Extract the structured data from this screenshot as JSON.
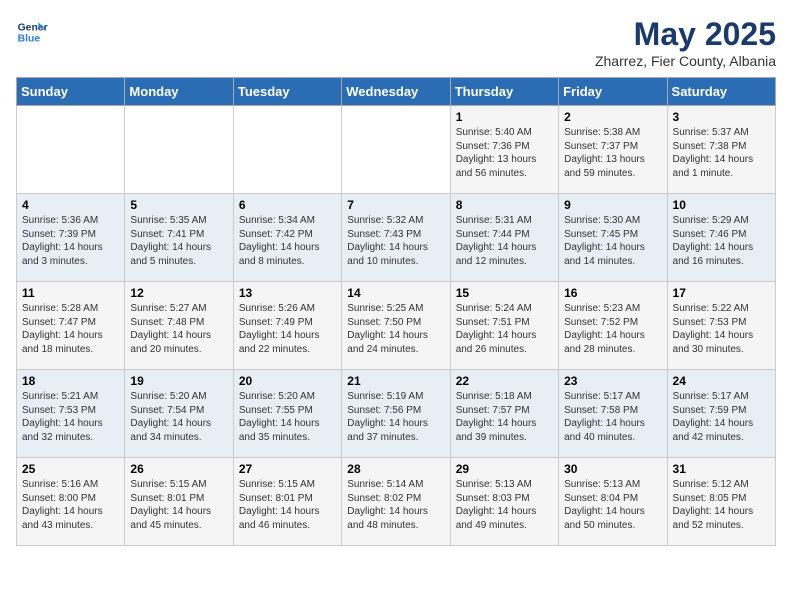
{
  "header": {
    "logo_line1": "General",
    "logo_line2": "Blue",
    "month_title": "May 2025",
    "subtitle": "Zharrez, Fier County, Albania"
  },
  "weekdays": [
    "Sunday",
    "Monday",
    "Tuesday",
    "Wednesday",
    "Thursday",
    "Friday",
    "Saturday"
  ],
  "weeks": [
    [
      {
        "day": "",
        "text": ""
      },
      {
        "day": "",
        "text": ""
      },
      {
        "day": "",
        "text": ""
      },
      {
        "day": "",
        "text": ""
      },
      {
        "day": "1",
        "text": "Sunrise: 5:40 AM\nSunset: 7:36 PM\nDaylight: 13 hours and 56 minutes."
      },
      {
        "day": "2",
        "text": "Sunrise: 5:38 AM\nSunset: 7:37 PM\nDaylight: 13 hours and 59 minutes."
      },
      {
        "day": "3",
        "text": "Sunrise: 5:37 AM\nSunset: 7:38 PM\nDaylight: 14 hours and 1 minute."
      }
    ],
    [
      {
        "day": "4",
        "text": "Sunrise: 5:36 AM\nSunset: 7:39 PM\nDaylight: 14 hours and 3 minutes."
      },
      {
        "day": "5",
        "text": "Sunrise: 5:35 AM\nSunset: 7:41 PM\nDaylight: 14 hours and 5 minutes."
      },
      {
        "day": "6",
        "text": "Sunrise: 5:34 AM\nSunset: 7:42 PM\nDaylight: 14 hours and 8 minutes."
      },
      {
        "day": "7",
        "text": "Sunrise: 5:32 AM\nSunset: 7:43 PM\nDaylight: 14 hours and 10 minutes."
      },
      {
        "day": "8",
        "text": "Sunrise: 5:31 AM\nSunset: 7:44 PM\nDaylight: 14 hours and 12 minutes."
      },
      {
        "day": "9",
        "text": "Sunrise: 5:30 AM\nSunset: 7:45 PM\nDaylight: 14 hours and 14 minutes."
      },
      {
        "day": "10",
        "text": "Sunrise: 5:29 AM\nSunset: 7:46 PM\nDaylight: 14 hours and 16 minutes."
      }
    ],
    [
      {
        "day": "11",
        "text": "Sunrise: 5:28 AM\nSunset: 7:47 PM\nDaylight: 14 hours and 18 minutes."
      },
      {
        "day": "12",
        "text": "Sunrise: 5:27 AM\nSunset: 7:48 PM\nDaylight: 14 hours and 20 minutes."
      },
      {
        "day": "13",
        "text": "Sunrise: 5:26 AM\nSunset: 7:49 PM\nDaylight: 14 hours and 22 minutes."
      },
      {
        "day": "14",
        "text": "Sunrise: 5:25 AM\nSunset: 7:50 PM\nDaylight: 14 hours and 24 minutes."
      },
      {
        "day": "15",
        "text": "Sunrise: 5:24 AM\nSunset: 7:51 PM\nDaylight: 14 hours and 26 minutes."
      },
      {
        "day": "16",
        "text": "Sunrise: 5:23 AM\nSunset: 7:52 PM\nDaylight: 14 hours and 28 minutes."
      },
      {
        "day": "17",
        "text": "Sunrise: 5:22 AM\nSunset: 7:53 PM\nDaylight: 14 hours and 30 minutes."
      }
    ],
    [
      {
        "day": "18",
        "text": "Sunrise: 5:21 AM\nSunset: 7:53 PM\nDaylight: 14 hours and 32 minutes."
      },
      {
        "day": "19",
        "text": "Sunrise: 5:20 AM\nSunset: 7:54 PM\nDaylight: 14 hours and 34 minutes."
      },
      {
        "day": "20",
        "text": "Sunrise: 5:20 AM\nSunset: 7:55 PM\nDaylight: 14 hours and 35 minutes."
      },
      {
        "day": "21",
        "text": "Sunrise: 5:19 AM\nSunset: 7:56 PM\nDaylight: 14 hours and 37 minutes."
      },
      {
        "day": "22",
        "text": "Sunrise: 5:18 AM\nSunset: 7:57 PM\nDaylight: 14 hours and 39 minutes."
      },
      {
        "day": "23",
        "text": "Sunrise: 5:17 AM\nSunset: 7:58 PM\nDaylight: 14 hours and 40 minutes."
      },
      {
        "day": "24",
        "text": "Sunrise: 5:17 AM\nSunset: 7:59 PM\nDaylight: 14 hours and 42 minutes."
      }
    ],
    [
      {
        "day": "25",
        "text": "Sunrise: 5:16 AM\nSunset: 8:00 PM\nDaylight: 14 hours and 43 minutes."
      },
      {
        "day": "26",
        "text": "Sunrise: 5:15 AM\nSunset: 8:01 PM\nDaylight: 14 hours and 45 minutes."
      },
      {
        "day": "27",
        "text": "Sunrise: 5:15 AM\nSunset: 8:01 PM\nDaylight: 14 hours and 46 minutes."
      },
      {
        "day": "28",
        "text": "Sunrise: 5:14 AM\nSunset: 8:02 PM\nDaylight: 14 hours and 48 minutes."
      },
      {
        "day": "29",
        "text": "Sunrise: 5:13 AM\nSunset: 8:03 PM\nDaylight: 14 hours and 49 minutes."
      },
      {
        "day": "30",
        "text": "Sunrise: 5:13 AM\nSunset: 8:04 PM\nDaylight: 14 hours and 50 minutes."
      },
      {
        "day": "31",
        "text": "Sunrise: 5:12 AM\nSunset: 8:05 PM\nDaylight: 14 hours and 52 minutes."
      }
    ]
  ]
}
